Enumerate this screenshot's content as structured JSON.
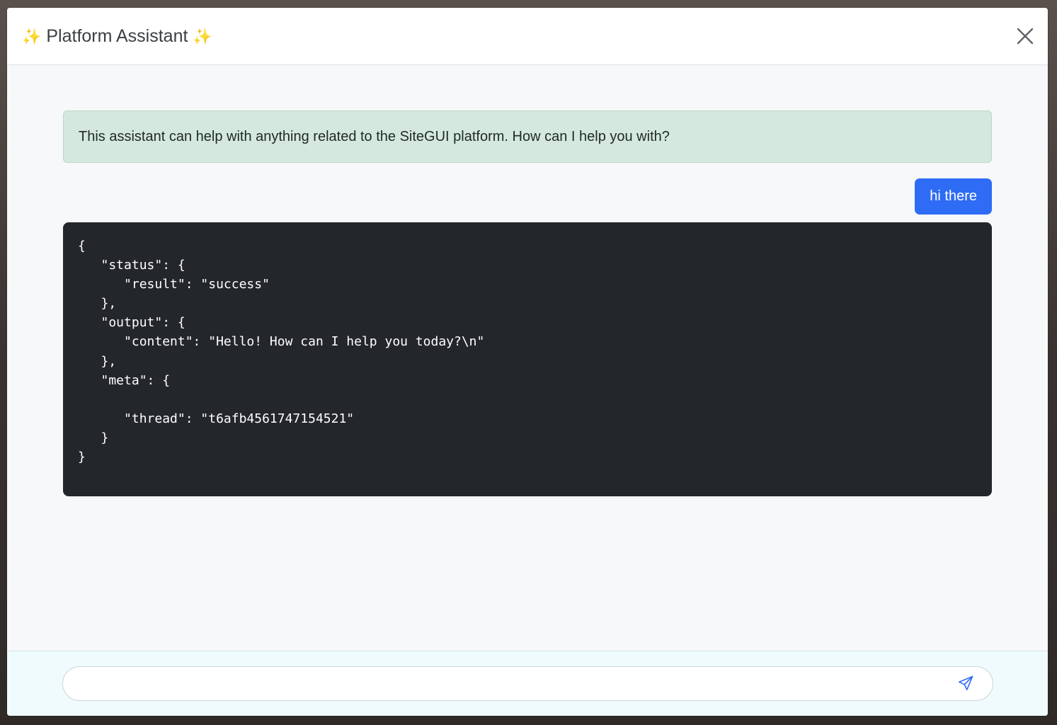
{
  "modal": {
    "title_prefix": "✨",
    "title": "Platform Assistant",
    "title_suffix": "✨"
  },
  "icons": {
    "close": "close-icon",
    "send": "send-icon"
  },
  "chat": {
    "intro": "This assistant can help with anything related to the SiteGUI platform. How can I help you with?",
    "user_message": "hi there",
    "response_code": "{\n   \"status\": {\n      \"result\": \"success\"\n   },\n   \"output\": {\n      \"content\": \"Hello! How can I help you today?\\n\"\n   },\n   \"meta\": {\n\n      \"thread\": \"t6afb4561747154521\"\n   }\n}"
  },
  "input": {
    "value": "",
    "placeholder": ""
  },
  "colors": {
    "user_bubble": "#2f6cf5",
    "intro_bg": "#d5e8df",
    "code_bg": "#23262b",
    "send_icon": "#2f6cf5"
  }
}
